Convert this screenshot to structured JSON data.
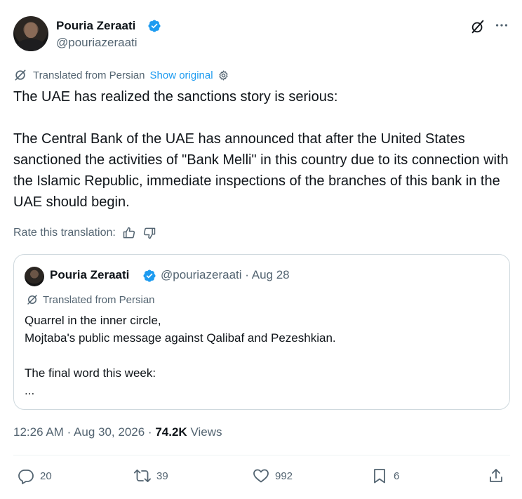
{
  "author": {
    "name": "Pouria Zeraati",
    "handle": "@pouriazeraati"
  },
  "translation": {
    "label": "Translated from Persian",
    "show_original": "Show original"
  },
  "tweet": {
    "text": "The UAE has realized the sanctions story is serious:\n\nThe Central Bank of the UAE has announced that after the United States sanctioned the activities of \"Bank Melli\" in this country due to its connection with the Islamic Republic, immediate inspections of the branches of this bank in the UAE should begin."
  },
  "rate": {
    "label": "Rate this translation:"
  },
  "quote": {
    "name": "Pouria Zeraati",
    "handle": "@pouriazeraati",
    "separator": "·",
    "date": "Aug 28",
    "translated_label": "Translated from Persian",
    "text": "Quarrel in the inner circle,\nMojtaba's public message against Qalibaf and Pezeshkian.\n\nThe final word this week:\n..."
  },
  "meta": {
    "time": "12:26 AM",
    "separator": "·",
    "date": "Aug 30, 2026",
    "views_count": "74.2K",
    "views_label": "Views"
  },
  "actions": {
    "replies": "20",
    "reposts": "39",
    "likes": "992",
    "bookmarks": "6"
  },
  "colors": {
    "accent": "#1d9bf0",
    "text_primary": "#0f1419",
    "text_secondary": "#536471",
    "border": "#cfd9de"
  },
  "icons": [
    "verified-badge-icon",
    "grok-icon",
    "more-icon",
    "translate-icon",
    "settings-icon",
    "thumbs-up-icon",
    "thumbs-down-icon",
    "reply-icon",
    "repost-icon",
    "like-icon",
    "bookmark-icon",
    "share-icon"
  ]
}
